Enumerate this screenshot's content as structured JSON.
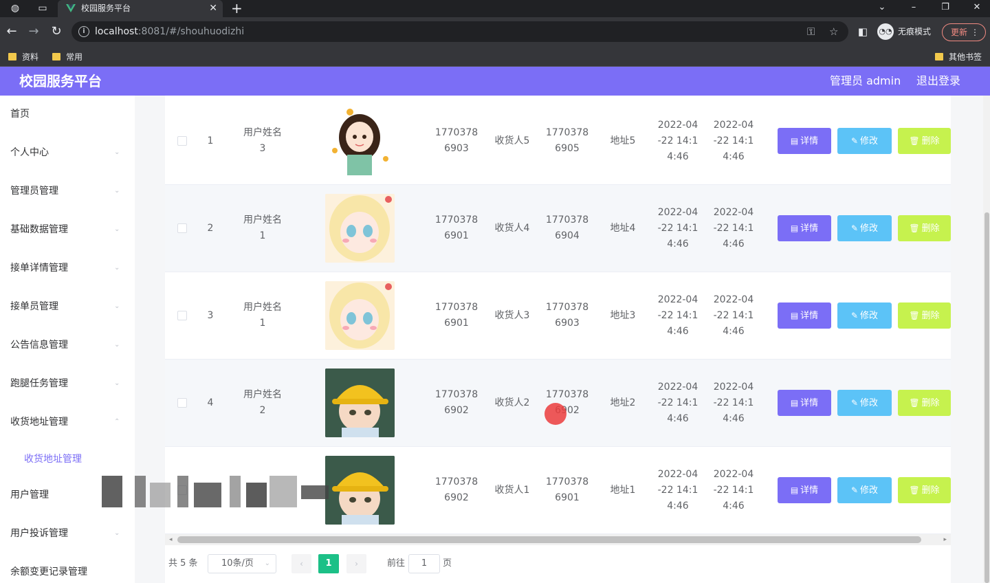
{
  "browser": {
    "tab_title": "校园服务平台",
    "url_host": "localhost",
    "url_rest": ":8081/#/shouhuodizhi",
    "incognito_label": "无痕模式",
    "update_label": "更新",
    "bookmarks": [
      "资料",
      "常用"
    ],
    "other_bookmarks": "其他书签"
  },
  "header": {
    "title": "校园服务平台",
    "user": "管理员 admin",
    "logout": "退出登录"
  },
  "sidebar": {
    "items": [
      {
        "label": "首页",
        "arrow": false
      },
      {
        "label": "个人中心",
        "arrow": true
      },
      {
        "label": "管理员管理",
        "arrow": true
      },
      {
        "label": "基础数据管理",
        "arrow": true
      },
      {
        "label": "接单详情管理",
        "arrow": true
      },
      {
        "label": "接单员管理",
        "arrow": true
      },
      {
        "label": "公告信息管理",
        "arrow": true
      },
      {
        "label": "跑腿任务管理",
        "arrow": true
      },
      {
        "label": "收货地址管理",
        "arrow": true
      }
    ],
    "active_sub": "收货地址管理",
    "items_after": [
      {
        "label": "用户管理",
        "arrow": true
      },
      {
        "label": "用户投诉管理",
        "arrow": true
      },
      {
        "label": "余额变更记录管理",
        "arrow": true
      }
    ]
  },
  "table": {
    "rows": [
      {
        "index": "1",
        "user": [
          "用户姓名",
          "3"
        ],
        "avatar": "girl-avatar",
        "phone": [
          "1770378",
          "6903"
        ],
        "receiver": "收货人5",
        "receiver_phone": [
          "1770378",
          "6905"
        ],
        "address": "地址5",
        "time1": [
          "2022-04",
          "-22 14:1",
          "4:46"
        ],
        "time2": [
          "2022-04",
          "-22 14:1",
          "4:46"
        ]
      },
      {
        "index": "2",
        "user": [
          "用户姓名",
          "1"
        ],
        "avatar": "anime-girl-avatar",
        "phone": [
          "1770378",
          "6901"
        ],
        "receiver": "收货人4",
        "receiver_phone": [
          "1770378",
          "6904"
        ],
        "address": "地址4",
        "time1": [
          "2022-04",
          "-22 14:1",
          "4:46"
        ],
        "time2": [
          "2022-04",
          "-22 14:1",
          "4:46"
        ]
      },
      {
        "index": "3",
        "user": [
          "用户姓名",
          "1"
        ],
        "avatar": "anime-girl-avatar",
        "phone": [
          "1770378",
          "6901"
        ],
        "receiver": "收货人3",
        "receiver_phone": [
          "1770378",
          "6903"
        ],
        "address": "地址3",
        "time1": [
          "2022-04",
          "-22 14:1",
          "4:46"
        ],
        "time2": [
          "2022-04",
          "-22 14:1",
          "4:46"
        ]
      },
      {
        "index": "4",
        "user": [
          "用户姓名",
          "2"
        ],
        "avatar": "boy-hat-avatar",
        "phone": [
          "1770378",
          "6902"
        ],
        "receiver": "收货人2",
        "receiver_phone": [
          "1770378",
          "6902"
        ],
        "address": "地址2",
        "time1": [
          "2022-04",
          "-22 14:1",
          "4:46"
        ],
        "time2": [
          "2022-04",
          "-22 14:1",
          "4:46"
        ]
      },
      {
        "index": "",
        "user": [
          "",
          ""
        ],
        "avatar": "boy-hat-avatar",
        "phone": [
          "1770378",
          "6902"
        ],
        "receiver": "收货人1",
        "receiver_phone": [
          "1770378",
          "6901"
        ],
        "address": "地址1",
        "time1": [
          "2022-04",
          "-22 14:1",
          "4:46"
        ],
        "time2": [
          "2022-04",
          "-22 14:1",
          "4:46"
        ]
      }
    ],
    "btn_detail": "详情",
    "btn_edit": "修改",
    "btn_delete": "删除"
  },
  "pagination": {
    "total": "共 5 条",
    "page_size": "10条/页",
    "current": "1",
    "goto_label": "前往",
    "goto_value": "1",
    "page_suffix": "页"
  },
  "colors": {
    "header": "#7b6ef6",
    "detail": "#7b6ef6",
    "edit": "#5cc3f7",
    "delete": "#c6f24e",
    "pager_active": "#1cc087"
  }
}
